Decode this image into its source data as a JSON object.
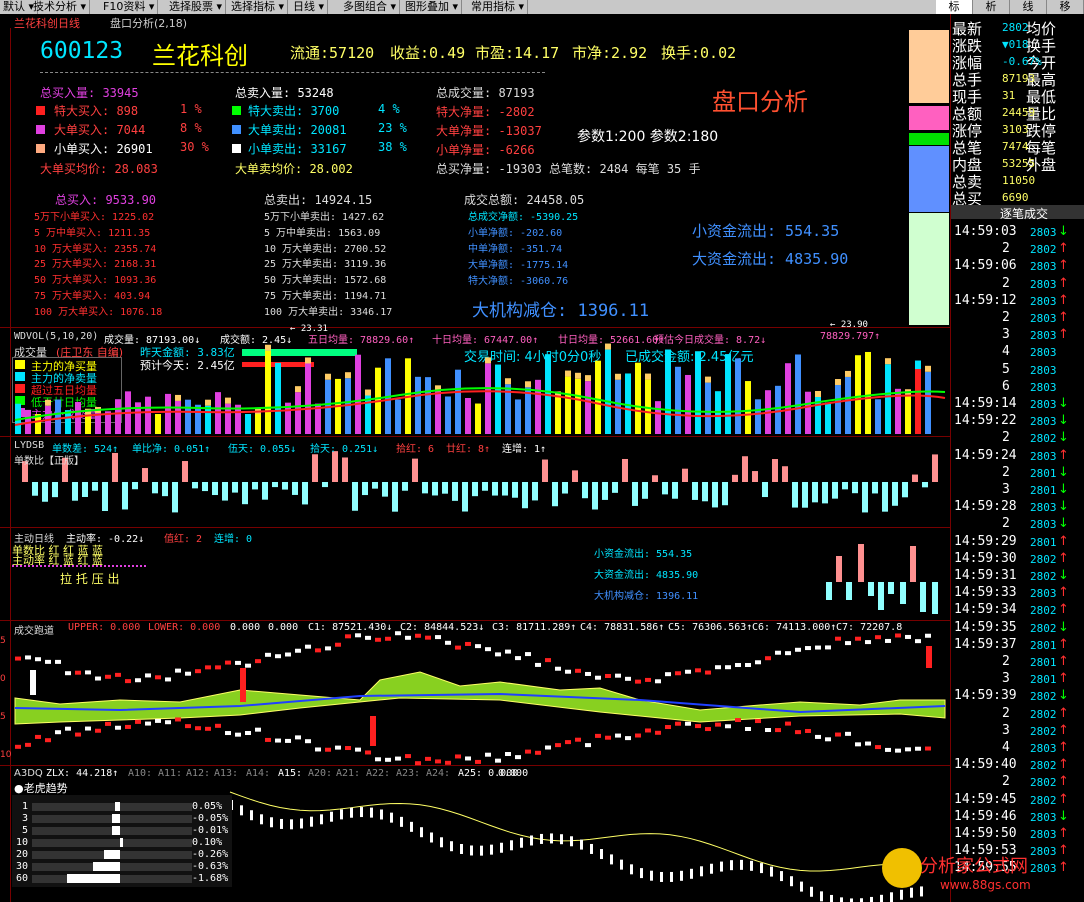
{
  "toolbar": [
    "默认",
    "技术分析",
    "F10资料",
    "选择股票",
    "选择指标",
    "日线",
    "多图组合",
    "图形叠加",
    "常用指标"
  ],
  "toolbar_right": [
    "标",
    "析",
    "线",
    "移"
  ],
  "title_bar": {
    "name": "兰花科创日线",
    "panel": "盘口分析(2,18)"
  },
  "header": {
    "code": "600123",
    "name": "兰花科创",
    "liutong": "流通:57120",
    "shouyi": "收益:0.49",
    "shiying": "市盈:14.17",
    "shijing": "市净:2.92",
    "huanshou": "换手:0.02"
  },
  "panel_title": "盘口分析",
  "params": "参数1:200  参数2:180",
  "buy": {
    "total": "总买入量: 33945",
    "rows": [
      {
        "label": "特大买入: 898",
        "pct": "1 %"
      },
      {
        "label": "大单买入: 7044",
        "pct": "8 %"
      },
      {
        "label": "小单买入: 26901",
        "pct": "30 %"
      }
    ],
    "avg": "大单买均价: 28.083"
  },
  "sell": {
    "total": "总卖入量: 53248",
    "rows": [
      {
        "label": "特大卖出: 3700",
        "pct": "4 %"
      },
      {
        "label": "大单卖出: 20081",
        "pct": "23 %"
      },
      {
        "label": "小单卖出: 33167",
        "pct": "38 %"
      }
    ],
    "avg": "大单卖均价: 28.002"
  },
  "deal": {
    "rows": [
      "总成交量: 87193",
      "特大净量: -2802",
      "大单净量: -13037",
      "小单净量: -6266"
    ],
    "last": "总买净量: -19303 总笔数: 2484 每笔  35 手"
  },
  "buy2": {
    "total": "总买入: 9533.90",
    "rows": [
      "5万下小单买入: 1225.02",
      "5 万中单买入: 1211.35",
      "10 万大单买入: 2355.74",
      "25 万大单买入: 2168.31",
      "50 万大单买入: 1093.36",
      "75 万大单买入: 403.94",
      "100 万大单买入: 1076.18"
    ]
  },
  "sell2": {
    "total": "总卖出: 14924.15",
    "rows": [
      "5万下小单卖出: 1427.62",
      "5 万中单卖出: 1563.09",
      "10 万大单卖出: 2700.52",
      "25 万大单卖出: 3119.36",
      "50 万大单卖出: 1572.68",
      "75 万大单卖出: 1194.71",
      "100 万大单卖出: 3346.17"
    ]
  },
  "deal2": {
    "total": "成交总额: 24458.05",
    "rows": [
      "总成交净额: -5390.25",
      "小单净额: -202.60",
      "中单净额: -351.74",
      "大单净额: -1775.14",
      "特大净额: -3060.76"
    ]
  },
  "flows": {
    "small": "小资金流出: 554.35",
    "big": "大资金流出: 4835.90",
    "inst": "大机构减仓: 1396.11"
  },
  "ind1": {
    "title": "WDVOL(5,10,20)",
    "vals": [
      "成交量: 87193.00↓",
      "成交额: 2.45↓",
      "五日均量: 78829.60↑",
      "十日均量: 67447.00↑",
      "廿日均量: 52661.60↑",
      "预估今日成交量: 8.72↓",
      "78829.797↑"
    ],
    "sub": "成交量",
    "sub2": "(庄卫东 自编)",
    "fund": "昨天金额: 3.83亿",
    "fund2": "预计今天: 2.45亿",
    "time": "交易时间: 4小时0分0秒",
    "amount": "已成交金额: 2.45亿元",
    "mark1": "23.31",
    "mark2": "23.90"
  },
  "legend": [
    {
      "t": "主力的净买量",
      "c": "#ffff00"
    },
    {
      "t": "主力的净卖量",
      "c": "#00e5ff"
    },
    {
      "t": "超过五日均量",
      "c": "#ff2020"
    },
    {
      "t": "低于廿日均量",
      "c": "#00ff00"
    },
    {
      "t": "主力外成交量",
      "c": "#e040e0"
    }
  ],
  "ind2": {
    "title": "LYDSB",
    "vals": [
      "单数差: 524↑",
      "单比净: 0.051↑",
      "伍天: 0.055↓",
      "拾天: 0.251↓",
      "拾红: 6",
      "廿红: 8↑",
      "连增: 1↑"
    ],
    "sub": "单数比【正版】"
  },
  "ind3": {
    "title": "主动日线",
    "vals": [
      "主动率: -0.22↓",
      "值红: 2",
      "连增: 0"
    ],
    "rows": [
      "单数比 红 红 蓝 蓝",
      "主动率 红 蓝 红 蓝"
    ],
    "bottom": "拉  托  压  出"
  },
  "ind4": {
    "title": "成交跑道",
    "vals": [
      "UPPER: 0.000",
      "LOWER: 0.000",
      "0.000",
      "0.000",
      "C1: 87521.430↓",
      "C2: 84844.523↓",
      "C3: 81711.289↑",
      "C4: 78831.586↑",
      "C5: 76306.563↑",
      "C6: 74113.000↑",
      "C7: 72207.8"
    ]
  },
  "ind5": {
    "title": "A3DQ",
    "vals": [
      "ZLX: 44.218↑",
      "A10:",
      "A11:",
      "A12:",
      "A13:",
      "A14:",
      "A15:",
      "A20:",
      "A21:",
      "A22:",
      "A23:",
      "A24:",
      "A25: 0.000",
      "0.000"
    ],
    "sub": "●老虎趋势"
  },
  "tiger": [
    {
      "d": "1",
      "v": "0.05%"
    },
    {
      "d": "3",
      "v": "-0.05%"
    },
    {
      "d": "5",
      "v": "-0.01%"
    },
    {
      "d": "10",
      "v": "0.10%"
    },
    {
      "d": "20",
      "v": "-0.26%"
    },
    {
      "d": "30",
      "v": "-0.63%"
    },
    {
      "d": "60",
      "v": "-1.68%"
    }
  ],
  "side_labels": [
    "最新",
    "涨跌",
    "涨幅",
    "总手",
    "现手",
    "总额",
    "涨停",
    "总笔",
    "内盘",
    "总卖",
    "总买"
  ],
  "side_right": [
    "均价",
    "换手",
    "今开",
    "最高",
    "最低",
    "量比",
    "跌停",
    "每笔",
    "外盘"
  ],
  "side_vals": [
    "2802",
    "▼018",
    "-0.67%",
    "87193",
    "31",
    "24459",
    "3103",
    "7474",
    "53255",
    "11050",
    "6690"
  ],
  "ticks_title": "逐笔成交",
  "ticks": [
    [
      "14:59:03",
      "2803",
      "↓"
    ],
    [
      "2",
      "2802",
      "↑"
    ],
    [
      "14:59:06",
      "2803",
      "↑"
    ],
    [
      "2",
      "2803",
      "↑"
    ],
    [
      "14:59:12",
      "2803",
      "↑"
    ],
    [
      "2",
      "2803",
      "↑"
    ],
    [
      "3",
      "2803",
      "↑"
    ],
    [
      "4",
      "2803",
      ""
    ],
    [
      "5",
      "2803",
      ""
    ],
    [
      "6",
      "2803",
      ""
    ],
    [
      "14:59:14",
      "2803",
      "↓"
    ],
    [
      "14:59:22",
      "2803",
      "↓"
    ],
    [
      "2",
      "2802",
      "↓"
    ],
    [
      "14:59:24",
      "2803",
      "↑"
    ],
    [
      "2",
      "2801",
      "↓"
    ],
    [
      "3",
      "2801",
      "↓"
    ],
    [
      "14:59:28",
      "2803",
      "↓"
    ],
    [
      "2",
      "2803",
      "↓"
    ],
    [
      "14:59:29",
      "2801",
      "↑"
    ],
    [
      "14:59:30",
      "2802",
      "↑"
    ],
    [
      "14:59:31",
      "2802",
      "↓"
    ],
    [
      "14:59:33",
      "2803",
      "↑"
    ],
    [
      "14:59:34",
      "2802",
      "↑"
    ],
    [
      "14:59:35",
      "2802",
      "↓"
    ],
    [
      "14:59:37",
      "2801",
      "↑"
    ],
    [
      "2",
      "2801",
      "↑"
    ],
    [
      "3",
      "2801",
      "↑"
    ],
    [
      "14:59:39",
      "2802",
      "↓"
    ],
    [
      "2",
      "2802",
      "↑"
    ],
    [
      "3",
      "2802",
      "↑"
    ],
    [
      "4",
      "2803",
      "↑"
    ],
    [
      "14:59:40",
      "2802",
      "↑"
    ],
    [
      "2",
      "2802",
      "↑"
    ],
    [
      "14:59:45",
      "2802",
      "↑"
    ],
    [
      "14:59:46",
      "2803",
      "↓"
    ],
    [
      "14:59:50",
      "2803",
      "↑"
    ],
    [
      "14:59:53",
      "2803",
      "↑"
    ],
    [
      "14:59:55",
      "2803",
      "↑"
    ]
  ],
  "left_ticks": [
    "5",
    "0",
    "5",
    "10"
  ],
  "watermark": {
    "text": "分析家公式网",
    "url": "www.88gs.com"
  },
  "colors": {
    "red": "#ff2020",
    "cyan": "#00e5ff",
    "yellow": "#ffff00",
    "green": "#00ff00",
    "magenta": "#e040e0",
    "pink": "#ff7090",
    "blue": "#4090ff"
  }
}
